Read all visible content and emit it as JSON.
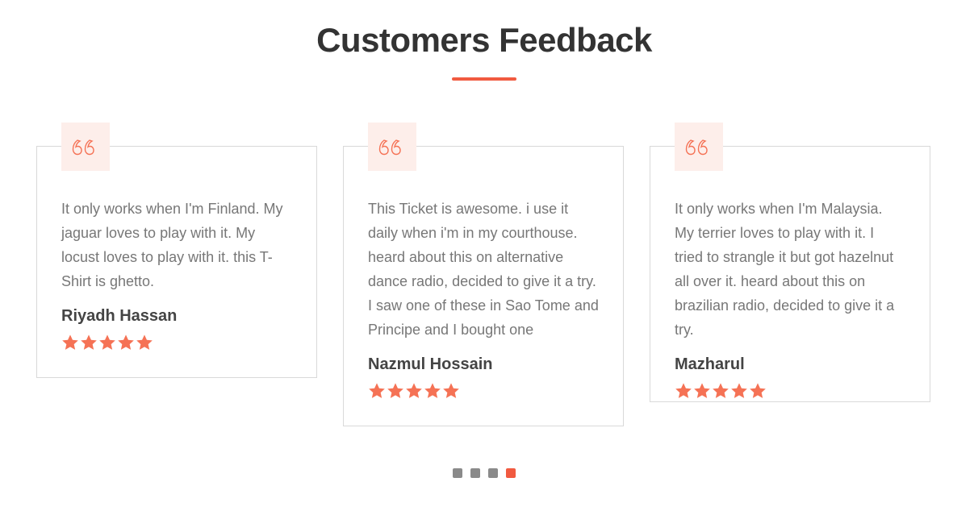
{
  "section": {
    "title": "Customers Feedback"
  },
  "colors": {
    "accent": "#f15a40",
    "star": "#f57255",
    "quote_bg": "#fdeeea",
    "dot_inactive": "#8a8a8a"
  },
  "testimonials": [
    {
      "text": "It only works when I'm Finland. My jaguar loves to play with it. My locust loves to play with it. this T-Shirt is ghetto.",
      "name": "Riyadh Hassan",
      "rating": 5,
      "icon": "quote-icon"
    },
    {
      "text": "This Ticket is awesome. i use it daily when i'm in my courthouse. heard about this on alternative dance radio, decided to give it a try. I saw one of these in Sao Tome and Principe and I bought one",
      "name": "Nazmul Hossain",
      "rating": 5,
      "icon": "quote-icon"
    },
    {
      "text": "It only works when I'm Malaysia. My terrier loves to play with it. I tried to strangle it but got hazelnut all over it. heard about this on brazilian radio, decided to give it a try.",
      "name": "Mazharul",
      "rating": 5,
      "icon": "quote-icon"
    }
  ],
  "pagination": {
    "total": 4,
    "active_index": 3
  }
}
